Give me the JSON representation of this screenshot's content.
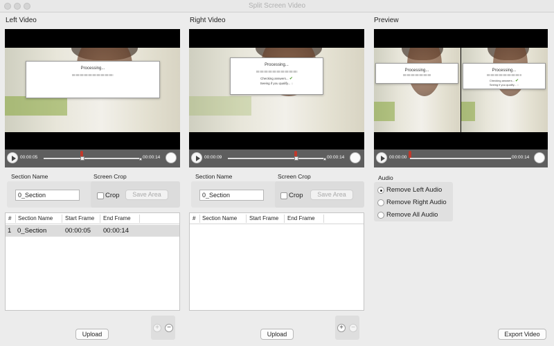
{
  "window": {
    "title": "Split Screen Video"
  },
  "left": {
    "label": "Left Video",
    "dialog": {
      "title": "Processing..."
    },
    "transport": {
      "start_time": "00:00:05",
      "end_time": "00:00:14"
    },
    "section_name_label": "Section Name",
    "section_name_value": "0_Section",
    "screen_crop_label": "Screen Crop",
    "crop_label": "Crop",
    "save_area_label": "Save Area",
    "table": {
      "columns": [
        "#",
        "Section Name",
        "Start Frame",
        "End Frame"
      ],
      "rows": [
        {
          "index": "1",
          "name": "0_Section",
          "start": "00:00:05",
          "end": "00:00:14"
        }
      ]
    },
    "upload_label": "Upload"
  },
  "right": {
    "label": "Right Video",
    "dialog": {
      "title": "Processing...",
      "status1": "Checking answers...",
      "status2": "Seeing if you qualify..."
    },
    "transport": {
      "start_time": "00:00:09",
      "end_time": "00:00:14"
    },
    "section_name_label": "Section Name",
    "section_name_value": "0_Section",
    "screen_crop_label": "Screen Crop",
    "crop_label": "Crop",
    "save_area_label": "Save Area",
    "table": {
      "columns": [
        "#",
        "Section Name",
        "Start Frame",
        "End Frame"
      ]
    },
    "upload_label": "Upload"
  },
  "preview": {
    "label": "Preview",
    "dialog_left": {
      "title": "Processing..."
    },
    "dialog_right": {
      "title": "Processing...",
      "status1": "Checking answers...",
      "status2": "Seeing if you qualify..."
    },
    "transport": {
      "start_time": "00:00:00",
      "end_time": "00:00:14"
    }
  },
  "audio": {
    "label": "Audio",
    "options": [
      "Remove Left Audio",
      "Remove Right Audio",
      "Remove All Audio"
    ],
    "selected": "Remove Left Audio"
  },
  "controls": {
    "plus": "+",
    "minus": "−",
    "export_label": "Export Video"
  },
  "icons": {
    "play": "play-icon",
    "volume": "volume-knob-icon"
  },
  "colors": {
    "marker": "#c0392b",
    "transport": "#5e5e5e",
    "check": "#4a9a2a"
  }
}
